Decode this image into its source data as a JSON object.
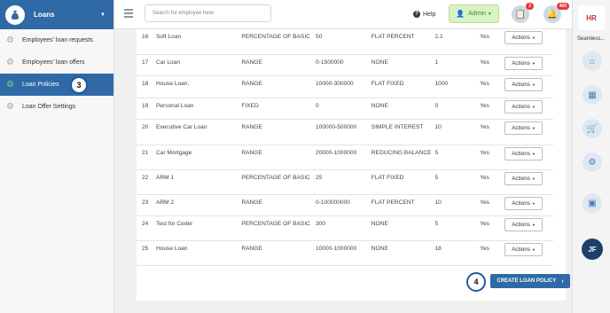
{
  "sidebar": {
    "title": "Loans",
    "items": [
      {
        "label": "Employees' loan requests"
      },
      {
        "label": "Employees' loan offers"
      },
      {
        "label": "Loan Policies"
      },
      {
        "label": "Loan Offer Settings"
      }
    ],
    "step_badge": "3"
  },
  "topbar": {
    "search_placeholder": "Search for employee here",
    "help_label": "Help",
    "admin_label": "Admin",
    "clipboard_count": "2",
    "notification_count": "460"
  },
  "table": {
    "rows": [
      {
        "num": "16",
        "name": "Soft Loan",
        "type": "PERCENTAGE OF BASIC",
        "value": "50",
        "interest": "FLAT PERCENT",
        "rate": "2.1",
        "active": "Yes",
        "action": "Actions"
      },
      {
        "num": "17",
        "name": "Car Loan",
        "type": "RANGE",
        "value": "0-1500000",
        "interest": "NONE",
        "rate": "1",
        "active": "Yes",
        "action": "Actions"
      },
      {
        "num": "18",
        "name": "House Loan.",
        "type": "RANGE",
        "value": "10000-300000",
        "interest": "FLAT FIXED",
        "rate": "1000",
        "active": "Yes",
        "action": "Actions"
      },
      {
        "num": "19",
        "name": "Personal Loan",
        "type": "FIXED",
        "value": "0",
        "interest": "NONE",
        "rate": "0",
        "active": "Yes",
        "action": "Actions"
      },
      {
        "num": "20",
        "name": "Executive Car Loan",
        "type": "RANGE",
        "value": "100000-500000",
        "interest": "SIMPLE INTEREST",
        "rate": "10",
        "active": "Yes",
        "action": "Actions"
      },
      {
        "num": "21",
        "name": "Car Mortgage",
        "type": "RANGE",
        "value": "20000-1000000",
        "interest": "REDUCING BALANCE",
        "rate": "5",
        "active": "Yes",
        "action": "Actions"
      },
      {
        "num": "22",
        "name": "ARM 1",
        "type": "PERCENTAGE OF BASIC",
        "value": "25",
        "interest": "FLAT FIXED",
        "rate": "5",
        "active": "Yes",
        "action": "Actions"
      },
      {
        "num": "23",
        "name": "ARM 2",
        "type": "RANGE",
        "value": "0-100000000",
        "interest": "FLAT PERCENT",
        "rate": "10",
        "active": "Yes",
        "action": "Actions"
      },
      {
        "num": "24",
        "name": "Test for Ceder",
        "type": "PERCENTAGE OF BASIC",
        "value": "300",
        "interest": "NONE",
        "rate": "5",
        "active": "Yes",
        "action": "Actions"
      },
      {
        "num": "25",
        "name": "House Loan",
        "type": "RANGE",
        "value": "10000-1000000",
        "interest": "NONE",
        "rate": "18",
        "active": "Yes",
        "action": "Actions"
      }
    ]
  },
  "create_button": {
    "label": "CREATE LOAN POLICY"
  },
  "create_step_badge": "4",
  "rail": {
    "label": "Seamless...",
    "avatar_initials": "JF"
  },
  "colors": {
    "primary": "#2f6aa6",
    "admin_bg": "#d9f2c4",
    "badge_red": "#e53935"
  }
}
